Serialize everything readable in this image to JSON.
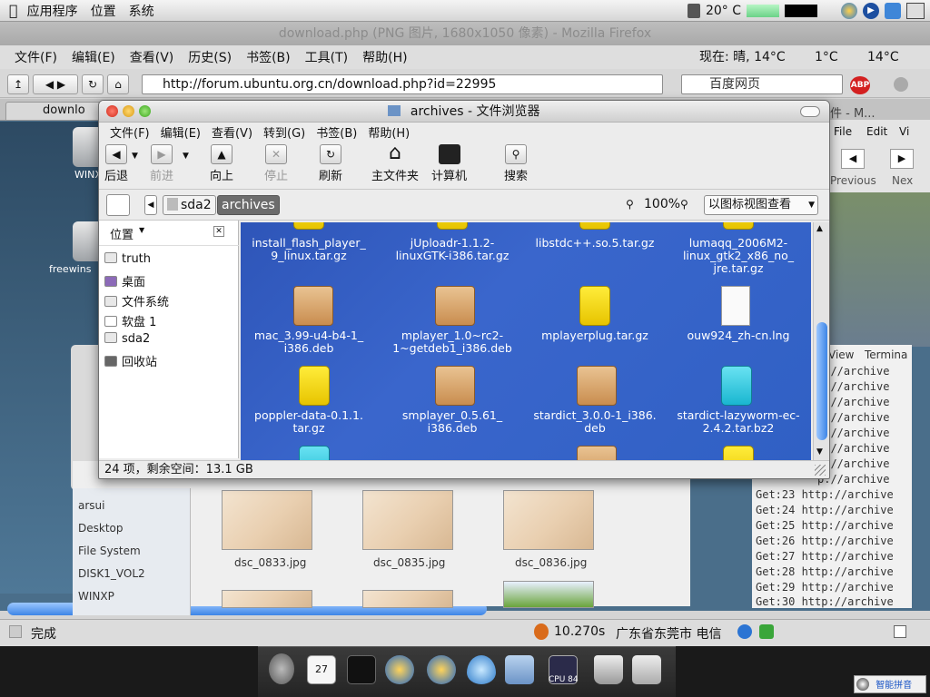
{
  "menubar": {
    "apple_icon": "apple-icon",
    "items": [
      "应用程序",
      "位置",
      "系统"
    ],
    "temperature": "20° C"
  },
  "firefox": {
    "title": "download.php (PNG 图片, 1680x1050 像素) - Mozilla Firefox",
    "menu": [
      "文件(F)",
      "编辑(E)",
      "查看(V)",
      "历史(S)",
      "书签(B)",
      "工具(T)",
      "帮助(H)"
    ],
    "weather_now": "现在: 晴, 14°C",
    "weather_2": "1°C",
    "weather_3": "14°C",
    "url": "http://forum.ubuntu.org.cn/download.php?id=22995",
    "search_placeholder": "百度网页",
    "tab_label": "downlo",
    "status_text": "完成",
    "status_time": "10.270s",
    "status_location": "广东省东莞市 电信"
  },
  "background": {
    "desktop_icons": [
      "WINXP",
      "freewins"
    ],
    "side_items": [
      "arsui",
      "Desktop",
      "File System",
      "DISK1_VOL2",
      "WINXP"
    ],
    "thumbs": [
      "dsc_0833.jpg",
      "dsc_0835.jpg",
      "dsc_0836.jpg"
    ],
    "right_window": {
      "labels": [
        "File",
        "Edit",
        "Vi"
      ],
      "buttons": [
        "Previous",
        "Nex"
      ]
    },
    "terminal": {
      "header": [
        "View",
        "Termina"
      ],
      "lines": [
        "p://archive",
        "p://archive",
        "p://archive",
        "p://archive",
        "p://archive",
        "p://archive",
        "p://archive",
        "p://archive",
        "p://archive",
        "Get:23 http://archive",
        "Get:24 http://archive",
        "Get:25 http://archive",
        "Get:26 http://archive",
        "Get:27 http://archive",
        "Get:28 http://archive",
        "Get:29 http://archive",
        "Get:30 http://archive"
      ]
    },
    "faded_text": "件 - M..."
  },
  "nautilus": {
    "title": "archives - 文件浏览器",
    "menu": [
      "文件(F)",
      "编辑(E)",
      "查看(V)",
      "转到(G)",
      "书签(B)",
      "帮助(H)"
    ],
    "toolbar": {
      "back": "后退",
      "forward": "前进",
      "up": "向上",
      "stop": "停止",
      "refresh": "刷新",
      "home": "主文件夹",
      "computer": "计算机",
      "search": "搜索"
    },
    "path": [
      "sda2",
      "archives"
    ],
    "zoom": "100%",
    "view_mode": "以图标视图查看",
    "sidebar_title": "位置",
    "places": [
      "truth",
      "桌面",
      "文件系统",
      "软盘 1",
      "sda2",
      "回收站"
    ],
    "files": [
      {
        "name": "install_flash_player_9_linux.tar.gz",
        "lines": [
          "install_flash_player_",
          "9_linux.tar.gz"
        ],
        "type": "tgz"
      },
      {
        "name": "jUploadr-1.1.2-linuxGTK-i386.tar.gz",
        "lines": [
          "jUploadr-1.1.2-",
          "linuxGTK-i386.tar.gz"
        ],
        "type": "tgz"
      },
      {
        "name": "libstdc++.so.5.tar.gz",
        "lines": [
          "libstdc++.so.5.tar.gz"
        ],
        "type": "tgz"
      },
      {
        "name": "lumaqq_2006M2-linux_gtk2_x86_no_jre.tar.gz",
        "lines": [
          "lumaqq_2006M2-",
          "linux_gtk2_x86_no_",
          "jre.tar.gz"
        ],
        "type": "tgz"
      },
      {
        "name": "mac_3.99-u4-b4-1_i386.deb",
        "lines": [
          "mac_3.99-u4-b4-1_",
          "i386.deb"
        ],
        "type": "deb"
      },
      {
        "name": "mplayer_1.0~rc2-1~getdeb1_i386.deb",
        "lines": [
          "mplayer_1.0~rc2-",
          "1~getdeb1_i386.deb"
        ],
        "type": "deb"
      },
      {
        "name": "mplayerplug.tar.gz",
        "lines": [
          "mplayerplug.tar.gz"
        ],
        "type": "tgz"
      },
      {
        "name": "ouw924_zh-cn.lng",
        "lines": [
          "ouw924_zh-cn.lng"
        ],
        "type": "doc"
      },
      {
        "name": "poppler-data-0.1.1.tar.gz",
        "lines": [
          "poppler-data-0.1.1.",
          "tar.gz"
        ],
        "type": "tgz"
      },
      {
        "name": "smplayer_0.5.61_i386.deb",
        "lines": [
          "smplayer_0.5.61_",
          "i386.deb"
        ],
        "type": "deb"
      },
      {
        "name": "stardict_3.0.0-1_i386.deb",
        "lines": [
          "stardict_3.0.0-1_i386.",
          "deb"
        ],
        "type": "deb"
      },
      {
        "name": "stardict-lazyworm-ec-2.4.2.tar.bz2",
        "lines": [
          "stardict-lazyworm-ec-",
          "2.4.2.tar.bz2"
        ],
        "type": "bz2"
      }
    ],
    "status": "24 项，剩余空间：13.1 GB",
    "badges": {
      "tgz": "TAR.GZ",
      "bz2": "TAR.BZ2",
      "deb": "debian"
    }
  },
  "dock": {
    "items": [
      "calendar-icon",
      "terminal-icon",
      "firefox-icon",
      "firefox-icon-2",
      "water-drop-icon",
      "folder-icon",
      "cpu-monitor-icon",
      "trash-icon",
      "disk-icon"
    ],
    "cpu_label": "CPU 84"
  },
  "ime_label": "智能拼音",
  "calendar_day": "27"
}
